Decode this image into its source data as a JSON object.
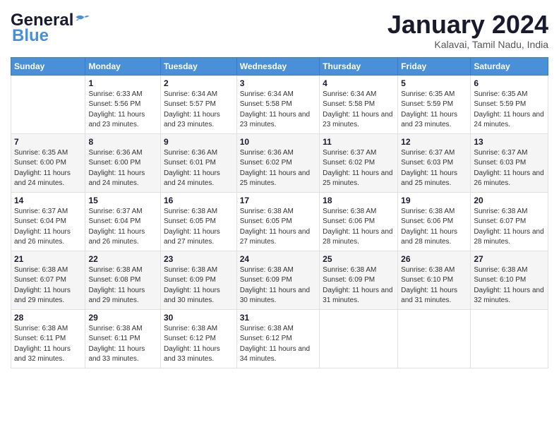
{
  "header": {
    "logo_general": "General",
    "logo_blue": "Blue",
    "month_title": "January 2024",
    "subtitle": "Kalavai, Tamil Nadu, India"
  },
  "columns": [
    "Sunday",
    "Monday",
    "Tuesday",
    "Wednesday",
    "Thursday",
    "Friday",
    "Saturday"
  ],
  "weeks": [
    [
      {
        "day": "",
        "sunrise": "",
        "sunset": "",
        "daylight": ""
      },
      {
        "day": "1",
        "sunrise": "Sunrise: 6:33 AM",
        "sunset": "Sunset: 5:56 PM",
        "daylight": "Daylight: 11 hours and 23 minutes."
      },
      {
        "day": "2",
        "sunrise": "Sunrise: 6:34 AM",
        "sunset": "Sunset: 5:57 PM",
        "daylight": "Daylight: 11 hours and 23 minutes."
      },
      {
        "day": "3",
        "sunrise": "Sunrise: 6:34 AM",
        "sunset": "Sunset: 5:58 PM",
        "daylight": "Daylight: 11 hours and 23 minutes."
      },
      {
        "day": "4",
        "sunrise": "Sunrise: 6:34 AM",
        "sunset": "Sunset: 5:58 PM",
        "daylight": "Daylight: 11 hours and 23 minutes."
      },
      {
        "day": "5",
        "sunrise": "Sunrise: 6:35 AM",
        "sunset": "Sunset: 5:59 PM",
        "daylight": "Daylight: 11 hours and 23 minutes."
      },
      {
        "day": "6",
        "sunrise": "Sunrise: 6:35 AM",
        "sunset": "Sunset: 5:59 PM",
        "daylight": "Daylight: 11 hours and 24 minutes."
      }
    ],
    [
      {
        "day": "7",
        "sunrise": "Sunrise: 6:35 AM",
        "sunset": "Sunset: 6:00 PM",
        "daylight": "Daylight: 11 hours and 24 minutes."
      },
      {
        "day": "8",
        "sunrise": "Sunrise: 6:36 AM",
        "sunset": "Sunset: 6:00 PM",
        "daylight": "Daylight: 11 hours and 24 minutes."
      },
      {
        "day": "9",
        "sunrise": "Sunrise: 6:36 AM",
        "sunset": "Sunset: 6:01 PM",
        "daylight": "Daylight: 11 hours and 24 minutes."
      },
      {
        "day": "10",
        "sunrise": "Sunrise: 6:36 AM",
        "sunset": "Sunset: 6:02 PM",
        "daylight": "Daylight: 11 hours and 25 minutes."
      },
      {
        "day": "11",
        "sunrise": "Sunrise: 6:37 AM",
        "sunset": "Sunset: 6:02 PM",
        "daylight": "Daylight: 11 hours and 25 minutes."
      },
      {
        "day": "12",
        "sunrise": "Sunrise: 6:37 AM",
        "sunset": "Sunset: 6:03 PM",
        "daylight": "Daylight: 11 hours and 25 minutes."
      },
      {
        "day": "13",
        "sunrise": "Sunrise: 6:37 AM",
        "sunset": "Sunset: 6:03 PM",
        "daylight": "Daylight: 11 hours and 26 minutes."
      }
    ],
    [
      {
        "day": "14",
        "sunrise": "Sunrise: 6:37 AM",
        "sunset": "Sunset: 6:04 PM",
        "daylight": "Daylight: 11 hours and 26 minutes."
      },
      {
        "day": "15",
        "sunrise": "Sunrise: 6:37 AM",
        "sunset": "Sunset: 6:04 PM",
        "daylight": "Daylight: 11 hours and 26 minutes."
      },
      {
        "day": "16",
        "sunrise": "Sunrise: 6:38 AM",
        "sunset": "Sunset: 6:05 PM",
        "daylight": "Daylight: 11 hours and 27 minutes."
      },
      {
        "day": "17",
        "sunrise": "Sunrise: 6:38 AM",
        "sunset": "Sunset: 6:05 PM",
        "daylight": "Daylight: 11 hours and 27 minutes."
      },
      {
        "day": "18",
        "sunrise": "Sunrise: 6:38 AM",
        "sunset": "Sunset: 6:06 PM",
        "daylight": "Daylight: 11 hours and 28 minutes."
      },
      {
        "day": "19",
        "sunrise": "Sunrise: 6:38 AM",
        "sunset": "Sunset: 6:06 PM",
        "daylight": "Daylight: 11 hours and 28 minutes."
      },
      {
        "day": "20",
        "sunrise": "Sunrise: 6:38 AM",
        "sunset": "Sunset: 6:07 PM",
        "daylight": "Daylight: 11 hours and 28 minutes."
      }
    ],
    [
      {
        "day": "21",
        "sunrise": "Sunrise: 6:38 AM",
        "sunset": "Sunset: 6:07 PM",
        "daylight": "Daylight: 11 hours and 29 minutes."
      },
      {
        "day": "22",
        "sunrise": "Sunrise: 6:38 AM",
        "sunset": "Sunset: 6:08 PM",
        "daylight": "Daylight: 11 hours and 29 minutes."
      },
      {
        "day": "23",
        "sunrise": "Sunrise: 6:38 AM",
        "sunset": "Sunset: 6:09 PM",
        "daylight": "Daylight: 11 hours and 30 minutes."
      },
      {
        "day": "24",
        "sunrise": "Sunrise: 6:38 AM",
        "sunset": "Sunset: 6:09 PM",
        "daylight": "Daylight: 11 hours and 30 minutes."
      },
      {
        "day": "25",
        "sunrise": "Sunrise: 6:38 AM",
        "sunset": "Sunset: 6:09 PM",
        "daylight": "Daylight: 11 hours and 31 minutes."
      },
      {
        "day": "26",
        "sunrise": "Sunrise: 6:38 AM",
        "sunset": "Sunset: 6:10 PM",
        "daylight": "Daylight: 11 hours and 31 minutes."
      },
      {
        "day": "27",
        "sunrise": "Sunrise: 6:38 AM",
        "sunset": "Sunset: 6:10 PM",
        "daylight": "Daylight: 11 hours and 32 minutes."
      }
    ],
    [
      {
        "day": "28",
        "sunrise": "Sunrise: 6:38 AM",
        "sunset": "Sunset: 6:11 PM",
        "daylight": "Daylight: 11 hours and 32 minutes."
      },
      {
        "day": "29",
        "sunrise": "Sunrise: 6:38 AM",
        "sunset": "Sunset: 6:11 PM",
        "daylight": "Daylight: 11 hours and 33 minutes."
      },
      {
        "day": "30",
        "sunrise": "Sunrise: 6:38 AM",
        "sunset": "Sunset: 6:12 PM",
        "daylight": "Daylight: 11 hours and 33 minutes."
      },
      {
        "day": "31",
        "sunrise": "Sunrise: 6:38 AM",
        "sunset": "Sunset: 6:12 PM",
        "daylight": "Daylight: 11 hours and 34 minutes."
      },
      {
        "day": "",
        "sunrise": "",
        "sunset": "",
        "daylight": ""
      },
      {
        "day": "",
        "sunrise": "",
        "sunset": "",
        "daylight": ""
      },
      {
        "day": "",
        "sunrise": "",
        "sunset": "",
        "daylight": ""
      }
    ]
  ]
}
